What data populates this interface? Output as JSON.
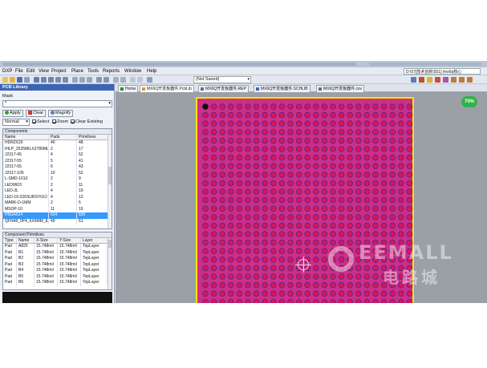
{
  "menubar": {
    "items": [
      "DXP",
      "File",
      "Edit",
      "View",
      "Project",
      "Place",
      "Tools",
      "Reports",
      "Window",
      "Help"
    ],
    "path": "D:\\07[技术创新\\551] imx6q核心"
  },
  "toolbar": {
    "combo_value": "(Not Saved)"
  },
  "panel": {
    "title": "PCB Library",
    "mask_label": "Mask",
    "mask_value": "*",
    "apply": "Apply",
    "clear": "Clear",
    "magnify": "Magnify",
    "mode_value": "Normal",
    "select_label": "Select",
    "zoom_label": "Zoom",
    "clear_existing_label": "Clear Existing",
    "components_title": "Components",
    "components_headers": [
      "Name",
      "Pads",
      "Primitives"
    ],
    "components": [
      [
        "HDR2X20",
        "40",
        "48"
      ],
      [
        "IHLP_2525MILX2780ML",
        "2",
        "17"
      ],
      [
        "J2317-45",
        "4",
        "52"
      ],
      [
        "J2317-55",
        "5",
        "41"
      ],
      [
        "J2317-65",
        "6",
        "43"
      ],
      [
        "J2317-105",
        "10",
        "52"
      ],
      [
        "L-SMD-1010",
        "2",
        "9"
      ],
      [
        "LED0603",
        "2",
        "11"
      ],
      [
        "LED-2L",
        "4",
        "19"
      ],
      [
        "LED-19-226SURSYGC/",
        "4",
        "13"
      ],
      [
        "MARK-D-1MM",
        "2",
        "5"
      ],
      [
        "MSOP-10",
        "11",
        "19"
      ],
      [
        "PBGA624",
        "624",
        "835"
      ],
      [
        "QFN48_0P4_6X6MM_E",
        "49",
        "61"
      ]
    ],
    "components_selected": 12,
    "primitives_title": "Component Primitives",
    "primitives_headers": [
      "Type",
      "Name",
      "X-Size",
      "Y-Size",
      "Layer"
    ],
    "primitives": [
      [
        "Pad",
        "A825",
        "15.748mil",
        "15.748mil",
        "TopLayer"
      ],
      [
        "Pad",
        "B1",
        "15.748mil",
        "15.748mil",
        "TopLayer"
      ],
      [
        "Pad",
        "B2",
        "15.748mil",
        "15.748mil",
        "TopLayer"
      ],
      [
        "Pad",
        "B3",
        "15.748mil",
        "15.748mil",
        "TopLayer"
      ],
      [
        "Pad",
        "B4",
        "15.748mil",
        "15.748mil",
        "TopLayer"
      ],
      [
        "Pad",
        "B5",
        "15.748mil",
        "15.748mil",
        "TopLayer"
      ],
      [
        "Pad",
        "B6",
        "15.748mil",
        "15.748mil",
        "TopLayer"
      ]
    ]
  },
  "tabs": [
    {
      "label": "Home",
      "color": "#2f8a3a"
    },
    {
      "label": "MX6Q开发板器件.PcbLib",
      "color": "#c8a020"
    },
    {
      "label": "MX6Q开发板器件.REP",
      "color": "#5c6e8c"
    },
    {
      "label": "MX6Q开发板器件.SCHLIB",
      "color": "#3c64b4"
    },
    {
      "label": "MX6Q开发板器件.csv",
      "color": "#5c6e8c"
    }
  ],
  "canvas": {
    "badge": "70%",
    "watermark_en": "EEMALL",
    "watermark_cn": "电路城",
    "board_color": "#cc2f8a",
    "pad_color": "#d8155a",
    "outline_color": "#ffe100"
  }
}
